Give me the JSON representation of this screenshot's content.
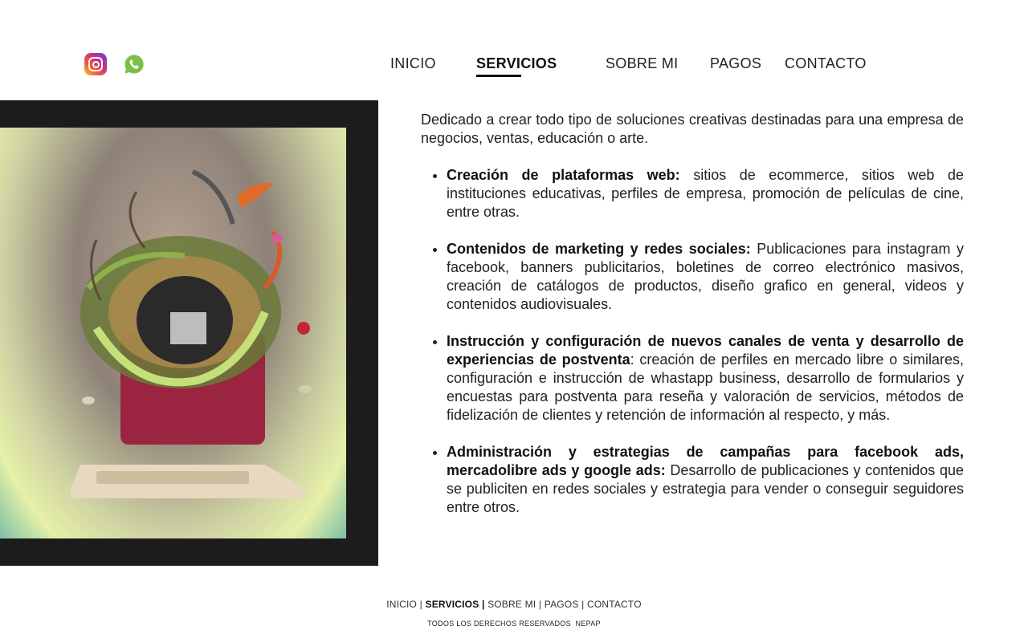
{
  "header": {
    "social": [
      {
        "icon": "instagram-icon"
      },
      {
        "icon": "whatsapp-icon"
      }
    ],
    "nav": [
      {
        "label": "INICIO"
      },
      {
        "label": "SERVICIOS"
      },
      {
        "label": "SOBRE MI"
      },
      {
        "label": "PAGOS"
      },
      {
        "label": "CONTACTO"
      }
    ],
    "active_nav": "SERVICIOS"
  },
  "main": {
    "intro": "Dedicado a crear todo tipo de soluciones creativas destinadas para una empresa de negocios, ventas, educación o arte.",
    "services": [
      {
        "title": "Creación de plataformas web:",
        "text": " sitios de ecommerce, sitios web de instituciones educativas, perfiles de empresa, promoción de películas de cine, entre otras."
      },
      {
        "title": "Contenidos de marketing y redes sociales:",
        "text": " Publicaciones para instagram y facebook, banners publicitarios, boletines de correo electrónico masivos, creación de catálogos de productos, diseño grafico en general, videos y contenidos audiovisuales."
      },
      {
        "title": "Instrucción y configuración de nuevos canales de venta y desarrollo de experiencias de postventa",
        "text": ": creación de perfiles en mercado libre o similares, configuración e instrucción de whastapp business, desarrollo de formularios y encuestas para postventa para reseña y valoración de servicios, métodos de fidelización de clientes y retención de información al respecto, y más."
      },
      {
        "title": "Administración y estrategias de campañas para facebook ads, mercadolibre ads y google ads:",
        "text": " Desarrollo de publicaciones y contenidos que se publiciten en redes sociales y estrategia para vender o conseguir seguidores entre otros."
      }
    ]
  },
  "footer": {
    "links": [
      "INICIO",
      "SERVICIOS",
      "SOBRE MI",
      "PAGOS",
      "CONTACTO"
    ],
    "separator": "|",
    "copyright": "TODOS LOS DERECHOS RESERVADOS  NEPAP"
  },
  "colors": {
    "accent": "#111111",
    "text": "#222222",
    "image_frame": "#1c1c1c",
    "whatsapp": "#7cc043"
  }
}
